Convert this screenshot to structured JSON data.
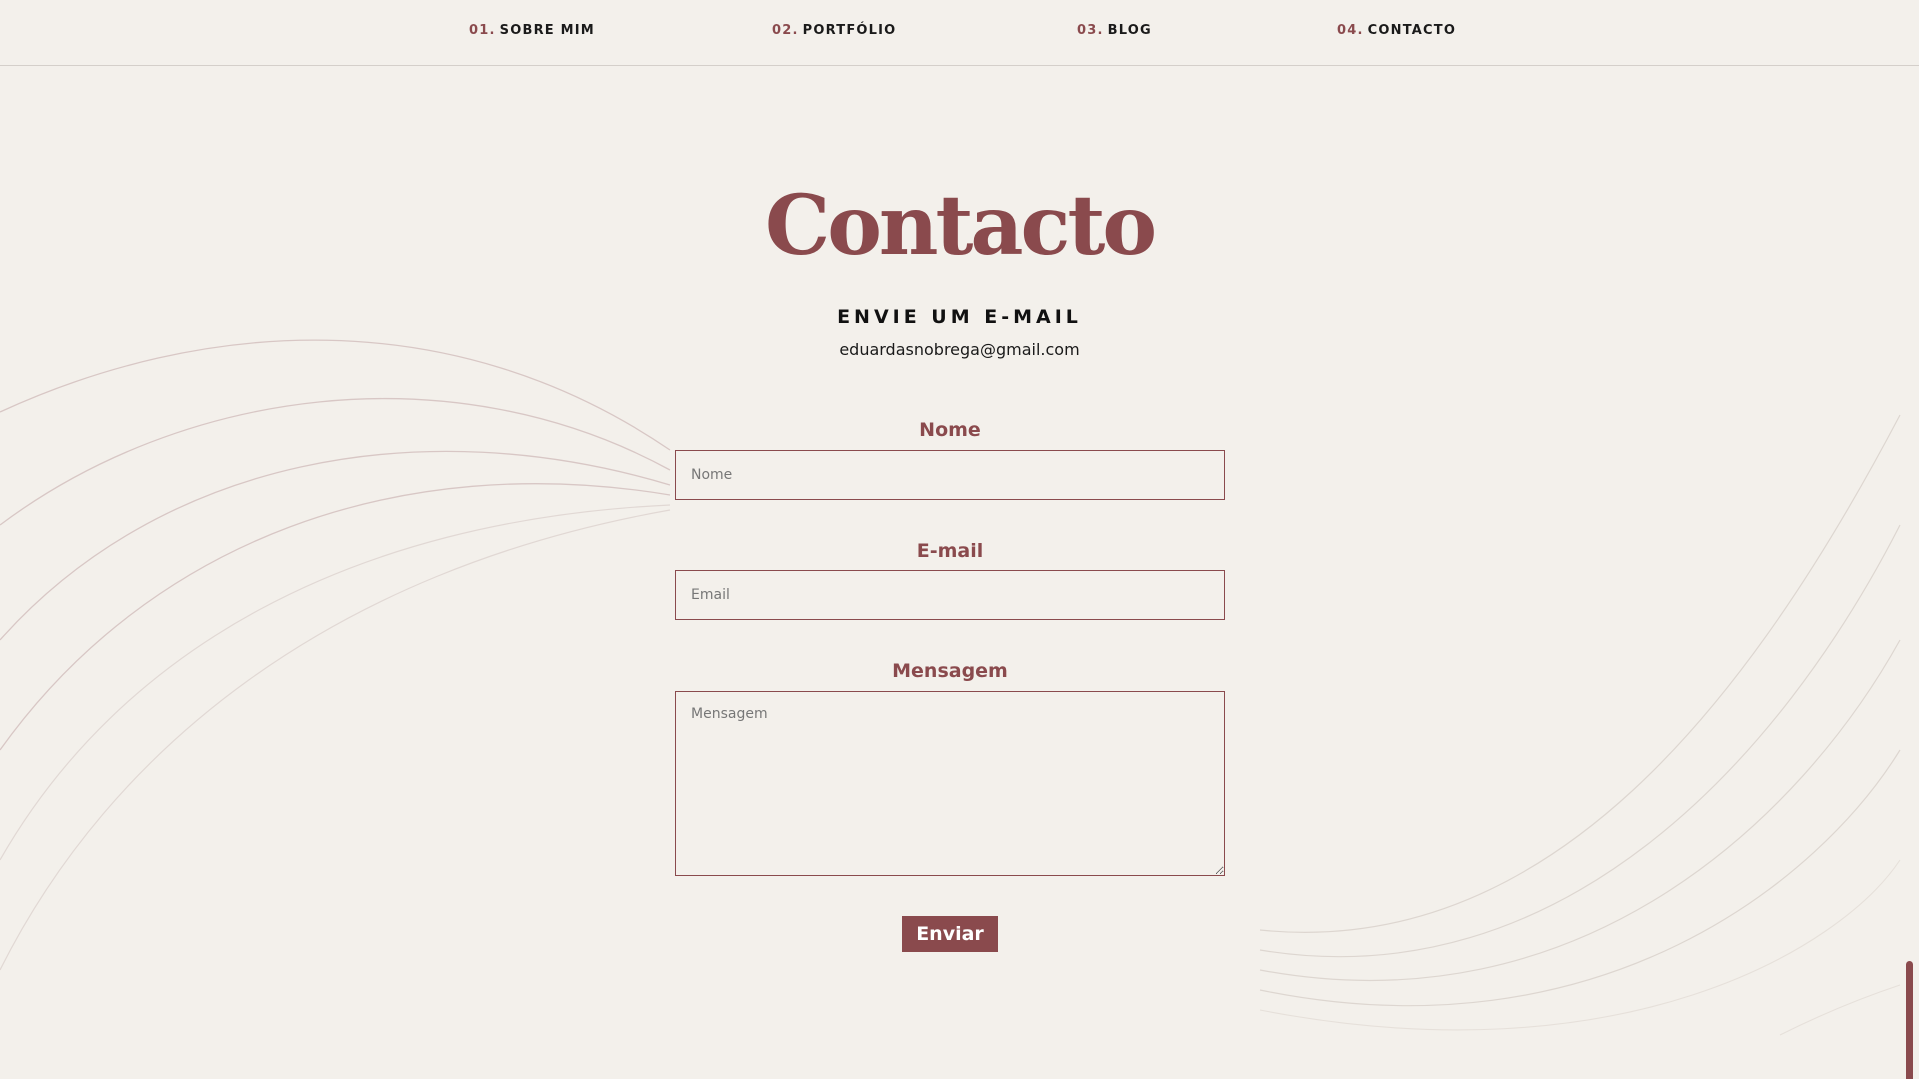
{
  "nav": {
    "items": [
      {
        "num": "01.",
        "label": "SOBRE MIM"
      },
      {
        "num": "02.",
        "label": "PORTFÓLIO"
      },
      {
        "num": "03.",
        "label": "BLOG"
      },
      {
        "num": "04.",
        "label": "CONTACTO"
      }
    ]
  },
  "contact": {
    "title": "Contacto",
    "subtitle": "ENVIE UM E-MAIL",
    "email": "eduardasnobrega@gmail.com"
  },
  "form": {
    "name_label": "Nome",
    "name_placeholder": "Nome",
    "email_label": "E-mail",
    "email_placeholder": "Email",
    "message_label": "Mensagem",
    "message_placeholder": "Mensagem",
    "submit_label": "Enviar"
  },
  "colors": {
    "accent": "#8a4a4d",
    "background": "#f3f0eb"
  }
}
